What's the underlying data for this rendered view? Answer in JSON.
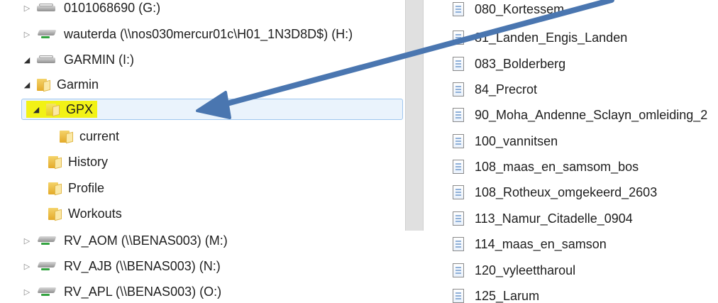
{
  "tree": {
    "items": [
      {
        "label": "0101068690 (G:)",
        "kind": "drive",
        "expander": "collapsed"
      },
      {
        "label": "wauterda (\\\\nos030mercur01c\\H01_1N3D8D$) (H:)",
        "kind": "netdrive",
        "expander": "collapsed"
      },
      {
        "label": "GARMIN (I:)",
        "kind": "drive",
        "expander": "expanded"
      },
      {
        "label": "Garmin",
        "kind": "folder",
        "expander": "expanded"
      },
      {
        "label": "GPX",
        "kind": "folder",
        "expander": "expanded",
        "selected": true
      },
      {
        "label": "current",
        "kind": "folder",
        "expander": "none"
      },
      {
        "label": "History",
        "kind": "folder",
        "expander": "none"
      },
      {
        "label": "Profile",
        "kind": "folder",
        "expander": "none"
      },
      {
        "label": "Workouts",
        "kind": "folder",
        "expander": "none"
      },
      {
        "label": "RV_AOM (\\\\BENAS003) (M:)",
        "kind": "netdrive",
        "expander": "collapsed"
      },
      {
        "label": "RV_AJB (\\\\BENAS003) (N:)",
        "kind": "netdrive",
        "expander": "collapsed"
      },
      {
        "label": "RV_APL (\\\\BENAS003) (O:)",
        "kind": "netdrive",
        "expander": "collapsed"
      }
    ]
  },
  "files": {
    "items": [
      "080_Kortessem",
      "81_Landen_Engis_Landen",
      "083_Bolderberg",
      "84_Precrot",
      "90_Moha_Andenne_Sclayn_omleiding_2",
      "100_vannitsen",
      "108_maas_en_samsom_bos",
      "108_Rotheux_omgekeerd_2603",
      "113_Namur_Citadelle_0904",
      "114_maas_en_samson",
      "120_vyleettharoul",
      "125_Larum"
    ]
  },
  "colors": {
    "highlight": "#f2f216",
    "arrow": "#4a76b0",
    "selection": "#eaf3fc"
  }
}
